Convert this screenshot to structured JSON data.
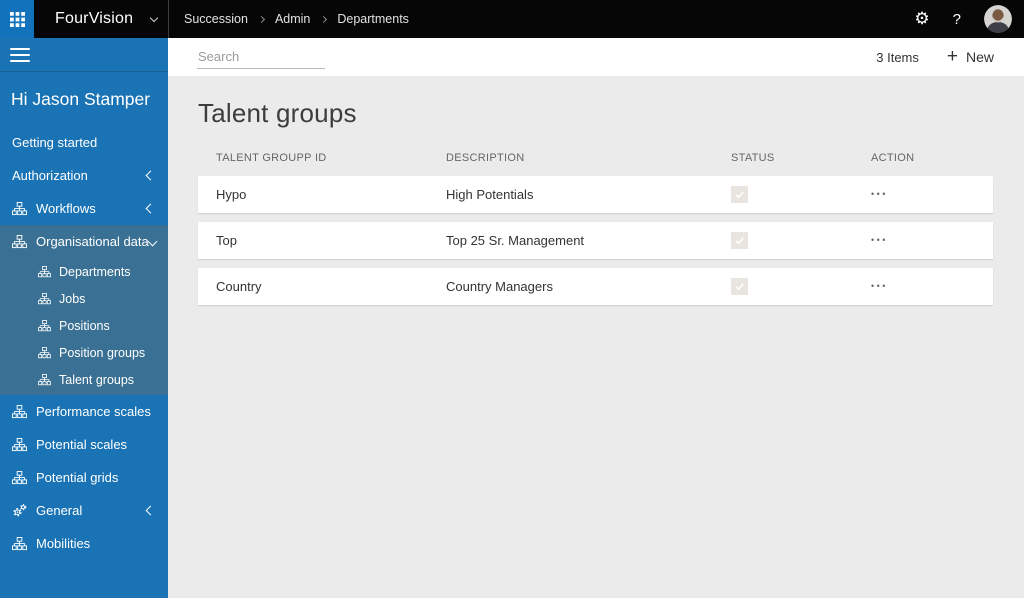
{
  "topbar": {
    "brand": "FourVision",
    "breadcrumb": [
      "Succession",
      "Admin",
      "Departments"
    ],
    "settings_glyph": "⚙",
    "help_glyph": "?"
  },
  "sidebar": {
    "greeting": "Hi Jason Stamper",
    "items": [
      {
        "label": "Getting started"
      },
      {
        "label": "Authorization",
        "chevron": "left"
      },
      {
        "label": "Workflows",
        "icon": "sitemap",
        "chevron": "left"
      },
      {
        "label": "Organisational data",
        "icon": "sitemap",
        "chevron": "down",
        "expanded": true,
        "children": [
          {
            "label": "Departments",
            "icon": "sitemap"
          },
          {
            "label": "Jobs",
            "icon": "sitemap"
          },
          {
            "label": "Positions",
            "icon": "sitemap"
          },
          {
            "label": "Position groups",
            "icon": "sitemap"
          },
          {
            "label": "Talent groups",
            "icon": "sitemap"
          }
        ]
      },
      {
        "label": "Performance scales",
        "icon": "sitemap"
      },
      {
        "label": "Potential scales",
        "icon": "sitemap"
      },
      {
        "label": "Potential grids",
        "icon": "sitemap"
      },
      {
        "label": "General",
        "icon": "gears",
        "chevron": "left"
      },
      {
        "label": "Mobilities",
        "icon": "sitemap"
      }
    ]
  },
  "toolbar": {
    "search_placeholder": "Search",
    "items_count": "3 Items",
    "new_plus": "+",
    "new_label": "New"
  },
  "main": {
    "title": "Talent groups",
    "table": {
      "columns": [
        "TALENT GROUPP ID",
        "DESCRIPTION",
        "STATUS",
        "ACTION"
      ],
      "action_glyph": "•••",
      "rows": [
        {
          "talent_group_id": "Hypo",
          "description": "High Potentials",
          "status_checked": true
        },
        {
          "talent_group_id": "Top",
          "description": "Top 25 Sr. Management",
          "status_checked": true
        },
        {
          "talent_group_id": "Country",
          "description": "Country Managers",
          "status_checked": true
        }
      ]
    }
  },
  "colors": {
    "topbar_bg": "#060606",
    "accent_blue": "#1273bc",
    "sidebar_bg": "#1a73b5",
    "sidebar_group_bg": "#3a7093",
    "content_bg": "#ebebeb",
    "card_bg": "#ffffff",
    "text_dark": "#3a3a3a",
    "muted_text": "#666666",
    "checkbox_bg": "#e8e5e0"
  }
}
